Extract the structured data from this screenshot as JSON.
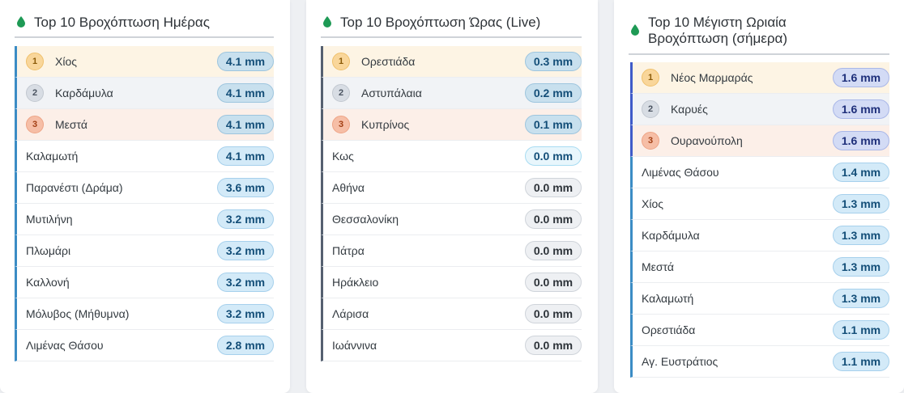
{
  "accent_colors": {
    "drop_icon": "#1e9a55",
    "bar_blue": "#3b8cc5",
    "bar_slate": "#556070",
    "bar_indigo": "#3f5bc9"
  },
  "icons": {
    "header": "water-drop-icon"
  },
  "cards": [
    {
      "title": "Top 10 Βροχόπτωση Ημέρας",
      "rows": [
        {
          "rank": "1",
          "name": "Χίος",
          "value": "4.1 mm"
        },
        {
          "rank": "2",
          "name": "Καρδάμυλα",
          "value": "4.1 mm"
        },
        {
          "rank": "3",
          "name": "Μεστά",
          "value": "4.1 mm"
        },
        {
          "rank": "",
          "name": "Καλαμωτή",
          "value": "4.1 mm"
        },
        {
          "rank": "",
          "name": "Παρανέστι (Δράμα)",
          "value": "3.6 mm"
        },
        {
          "rank": "",
          "name": "Μυτιλήνη",
          "value": "3.2 mm"
        },
        {
          "rank": "",
          "name": "Πλωμάρι",
          "value": "3.2 mm"
        },
        {
          "rank": "",
          "name": "Καλλονή",
          "value": "3.2 mm"
        },
        {
          "rank": "",
          "name": "Μόλυβος (Μήθυμνα)",
          "value": "3.2 mm"
        },
        {
          "rank": "",
          "name": "Λιμένας Θάσου",
          "value": "2.8 mm"
        }
      ]
    },
    {
      "title": "Top 10 Βροχόπτωση Ώρας (Live)",
      "rows": [
        {
          "rank": "1",
          "name": "Ορεστιάδα",
          "value": "0.3 mm"
        },
        {
          "rank": "2",
          "name": "Αστυπάλαια",
          "value": "0.2 mm"
        },
        {
          "rank": "3",
          "name": "Κυπρίνος",
          "value": "0.1 mm"
        },
        {
          "rank": "",
          "name": "Κως",
          "value": "0.0 mm"
        },
        {
          "rank": "",
          "name": "Αθήνα",
          "value": "0.0 mm"
        },
        {
          "rank": "",
          "name": "Θεσσαλονίκη",
          "value": "0.0 mm"
        },
        {
          "rank": "",
          "name": "Πάτρα",
          "value": "0.0 mm"
        },
        {
          "rank": "",
          "name": "Ηράκλειο",
          "value": "0.0 mm"
        },
        {
          "rank": "",
          "name": "Λάρισα",
          "value": "0.0 mm"
        },
        {
          "rank": "",
          "name": "Ιωάννινα",
          "value": "0.0 mm"
        }
      ]
    },
    {
      "title_line1": "Top 10 Μέγιστη Ωριαία",
      "title_line2": "Βροχόπτωση (σήμερα)",
      "rows": [
        {
          "rank": "1",
          "name": "Νέος Μαρμαράς",
          "value": "1.6 mm"
        },
        {
          "rank": "2",
          "name": "Καρυές",
          "value": "1.6 mm"
        },
        {
          "rank": "3",
          "name": "Ουρανούπολη",
          "value": "1.6 mm"
        },
        {
          "rank": "",
          "name": "Λιμένας Θάσου",
          "value": "1.4 mm"
        },
        {
          "rank": "",
          "name": "Χίος",
          "value": "1.3 mm"
        },
        {
          "rank": "",
          "name": "Καρδάμυλα",
          "value": "1.3 mm"
        },
        {
          "rank": "",
          "name": "Μεστά",
          "value": "1.3 mm"
        },
        {
          "rank": "",
          "name": "Καλαμωτή",
          "value": "1.3 mm"
        },
        {
          "rank": "",
          "name": "Ορεστιάδα",
          "value": "1.1 mm"
        },
        {
          "rank": "",
          "name": "Αγ. Ευστράτιος",
          "value": "1.1 mm"
        }
      ]
    }
  ]
}
